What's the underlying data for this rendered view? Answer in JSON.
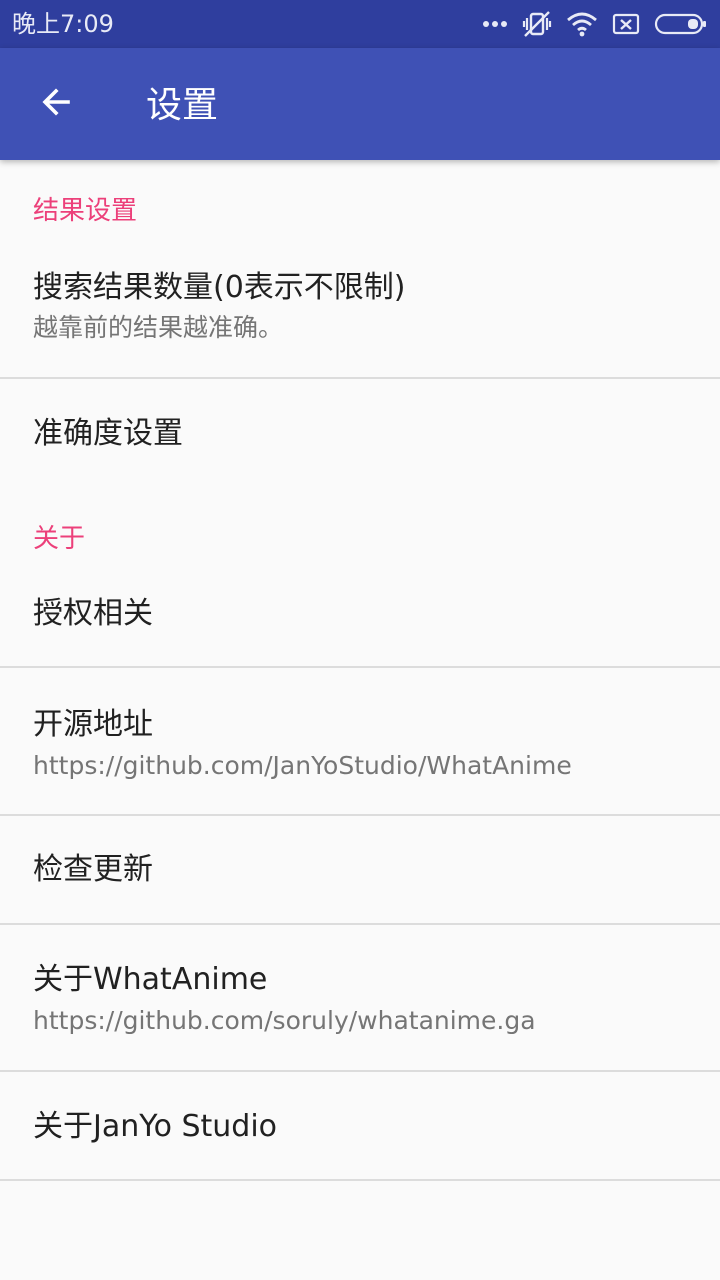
{
  "status_bar": {
    "time": "晚上7:09",
    "icons": [
      "more-dots-icon",
      "vibrate-off-icon",
      "wifi-icon",
      "sim-x-icon",
      "battery-icon"
    ]
  },
  "app_bar": {
    "back_icon": "arrow-left-icon",
    "title": "设置"
  },
  "colors": {
    "status_bar": "#2f3e9e",
    "app_bar": "#3f51b5",
    "category": "#ec407a",
    "background": "#fafafa"
  },
  "sections": {
    "results": {
      "header": "结果设置",
      "items": [
        {
          "title": "搜索结果数量(0表示不限制)",
          "summary": "越靠前的结果越准确。"
        },
        {
          "title": "准确度设置"
        }
      ]
    },
    "about": {
      "header": "关于",
      "items": [
        {
          "title": "授权相关"
        },
        {
          "title": "开源地址",
          "summary": "https://github.com/JanYoStudio/WhatAnime"
        },
        {
          "title": "检查更新"
        },
        {
          "title": "关于WhatAnime",
          "summary": "https://github.com/soruly/whatanime.ga"
        },
        {
          "title": "关于JanYo Studio"
        }
      ]
    }
  }
}
